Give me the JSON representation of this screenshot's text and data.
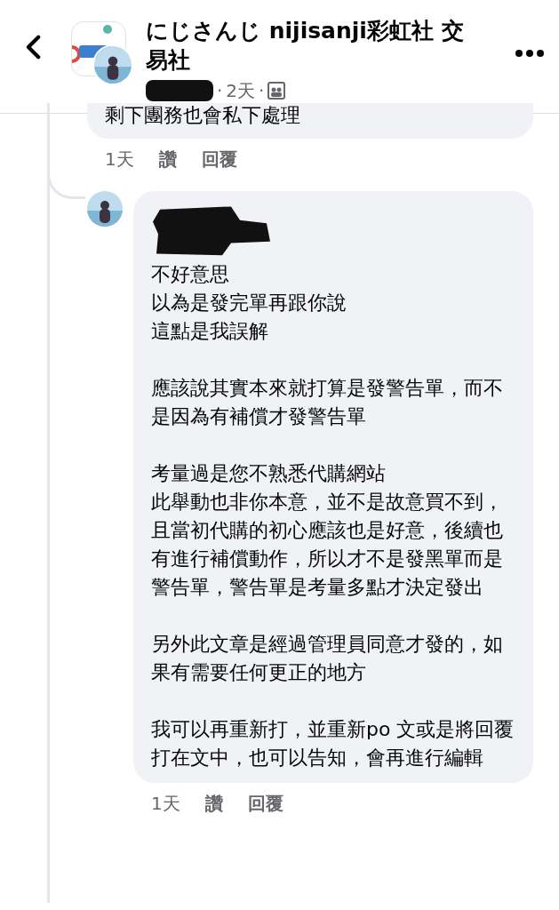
{
  "header": {
    "title": "にじさんじ nijisanji彩虹社 交易社",
    "time": "2天",
    "separator_1": "·",
    "separator_2": "·"
  },
  "previous_comment": {
    "text": "剩下團務也會私下處理",
    "actions": [
      "1天",
      "讚",
      "回覆"
    ]
  },
  "reply": {
    "paragraphs": [
      [
        "不好意思",
        "以為是發完單再跟你說",
        "這點是我誤解"
      ],
      [
        "應該說其實本來就打算是發警告單，而不是因為有補償才發警告單"
      ],
      [
        "考量過是您不熟悉代購網站",
        "此舉動也非你本意，並不是故意買不到，且當初代購的初心應該也是好意，後續也有進行補償動作，所以才不是發黑單而是警告單，警告單是考量多點才決定發出"
      ],
      [
        "另外此文章是經過管理員同意才發的，如果有需要任何更正的地方"
      ],
      [
        "我可以再重新打，並重新po 文或是將回覆打在文中，也可以告知，會再進行編輯"
      ]
    ],
    "actions": [
      "1天",
      "讚",
      "回覆"
    ]
  }
}
